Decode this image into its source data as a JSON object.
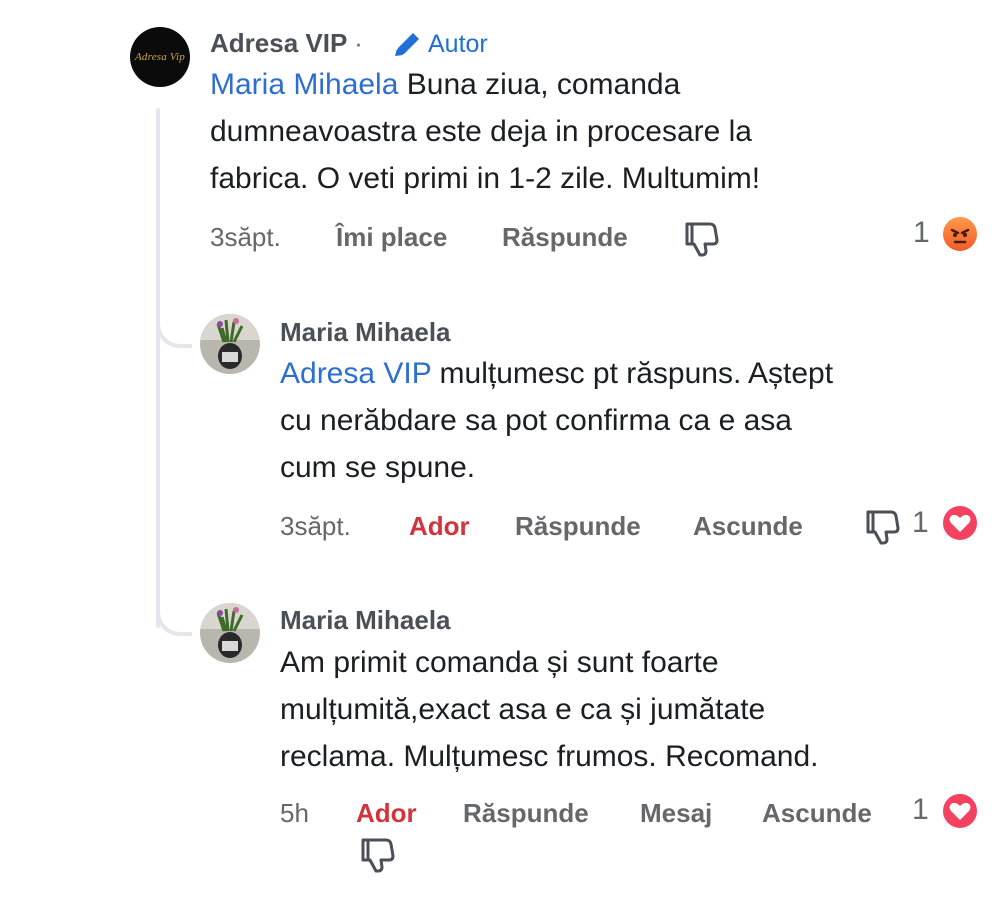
{
  "comments": [
    {
      "author": "Adresa VIP",
      "separator": "·",
      "author_badge": "Autor",
      "avatar_text": "Adresa Vip",
      "mention": "Maria Mihaela",
      "text_lines": [
        " Buna ziua, comanda",
        "dumneavoastra este deja in procesare la",
        "fabrica. O veti primi in 1-2 zile. Multumim!"
      ],
      "time": "3săpt.",
      "like_label": "Îmi place",
      "reply_label": "Răspunde",
      "reaction_count": "1",
      "reaction_type": "angry"
    },
    {
      "author": "Maria Mihaela",
      "mention": "Adresa VIP",
      "text_lines": [
        " mulțumesc pt răspuns. Aștept",
        "cu nerăbdare sa pot confirma ca e asa",
        "cum se spune."
      ],
      "time": "3săpt.",
      "like_label": "Ador",
      "reply_label": "Răspunde",
      "hide_label": "Ascunde",
      "reaction_count": "1",
      "reaction_type": "love"
    },
    {
      "author": "Maria Mihaela",
      "text_lines": [
        "Am primit comanda și sunt foarte",
        "mulțumită,exact asa e ca și jumătate",
        "reclama. Mulțumesc frumos.  Recomand."
      ],
      "time": "5h",
      "like_label": "Ador",
      "reply_label": "Răspunde",
      "message_label": "Mesaj",
      "hide_label": "Ascunde",
      "reaction_count": "1",
      "reaction_type": "love"
    }
  ],
  "colors": {
    "mention": "#2d6fd1",
    "ador": "#d0343d",
    "meta": "#65676b",
    "thread_line": "#e4e6eb"
  }
}
